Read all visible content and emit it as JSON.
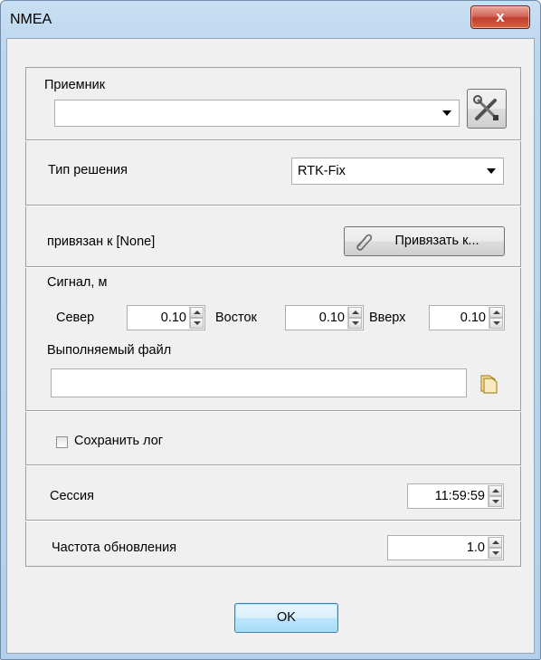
{
  "window": {
    "title": "NMEA",
    "close_label": "x"
  },
  "receiver": {
    "label": "Приемник",
    "value": ""
  },
  "solution": {
    "label": "Тип решения",
    "value": "RTK-Fix"
  },
  "binding": {
    "label": "привязан к [None]",
    "button_label": "Привязать к..."
  },
  "signal": {
    "label": "Сигнал, м",
    "north": {
      "label": "Север",
      "value": "0.10"
    },
    "east": {
      "label": "Восток",
      "value": "0.10"
    },
    "up": {
      "label": "Вверх",
      "value": "0.10"
    }
  },
  "executable": {
    "label": "Выполняемый файл",
    "value": ""
  },
  "save_log": {
    "label": "Сохранить лог",
    "checked": false
  },
  "session": {
    "label": "Сессия",
    "value": "11:59:59"
  },
  "update_rate": {
    "label": "Частота обновления",
    "value": "1.0"
  },
  "footer": {
    "ok_label": "OK"
  },
  "icons": {
    "settings": "tools-icon",
    "browse": "folder-icon",
    "attach": "paperclip-icon"
  },
  "colors": {
    "frame": "#bcd6ee",
    "close": "#c7483a",
    "client": "#f0f0f0"
  }
}
